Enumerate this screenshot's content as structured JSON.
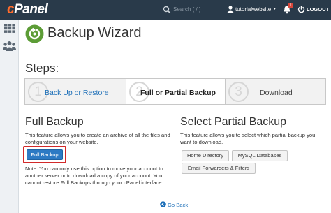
{
  "header": {
    "logo_c": "c",
    "logo_rest": "Panel",
    "search_placeholder": "Search ( / )",
    "username": "tutorialwebsite",
    "user_caret": "▾",
    "notification_count": "1",
    "logout_label": "LOGOUT"
  },
  "page": {
    "title": "Backup Wizard",
    "steps_heading": "Steps:",
    "steps": [
      {
        "number": "1",
        "label": "Back Up or Restore"
      },
      {
        "number": "2",
        "label": "Full or Partial Backup"
      },
      {
        "number": "3",
        "label": "Download"
      }
    ]
  },
  "full_backup": {
    "heading": "Full Backup",
    "description": "This feature allows you to create an archive of all the files and configurations on your website.",
    "button_label": "Full Backup",
    "note": "Note: You can only use this option to move your account to another server or to download a copy of your account. You cannot restore Full Backups through your cPanel interface."
  },
  "partial_backup": {
    "heading": "Select Partial Backup",
    "description": "This feature allows you to select which partial backup you want to download.",
    "buttons": [
      "Home Directory",
      "MySQL Databases",
      "Email Forwarders & Filters"
    ]
  },
  "go_back_label": "Go Back",
  "colors": {
    "topbar": "#293a4a",
    "brand_accent": "#ff6c2c",
    "primary_button": "#2d7ac4",
    "highlight_outline": "#d22a2a",
    "link": "#1d6fb8"
  },
  "icons": [
    "search-icon",
    "user-icon",
    "bell-icon",
    "logout-icon",
    "grid-icon",
    "users-icon",
    "backup-wizard-icon",
    "back-arrow-icon"
  ]
}
